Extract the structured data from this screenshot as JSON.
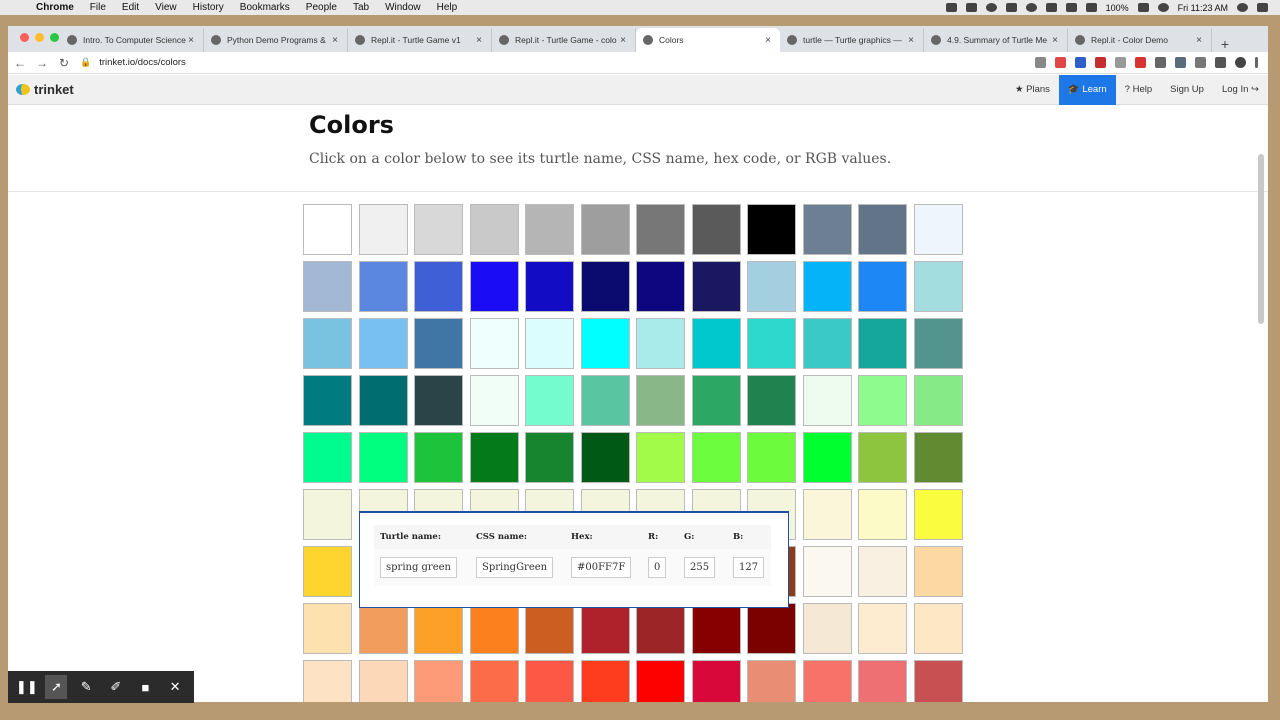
{
  "menubar": {
    "app": "Chrome",
    "items": [
      "File",
      "Edit",
      "View",
      "History",
      "Bookmarks",
      "People",
      "Tab",
      "Window",
      "Help"
    ],
    "battery": "100%",
    "clock": "Fri 11:23 AM"
  },
  "browser": {
    "tabs": [
      {
        "title": "Intro. To Computer Science",
        "active": false
      },
      {
        "title": "Python Demo Programs &",
        "active": false
      },
      {
        "title": "Repl.it - Turtle Game v1",
        "active": false
      },
      {
        "title": "Repl.it - Turtle Game - colo",
        "active": false
      },
      {
        "title": "Colors",
        "active": true
      },
      {
        "title": "turtle — Turtle graphics —",
        "active": false
      },
      {
        "title": "4.9. Summary of Turtle Me",
        "active": false
      },
      {
        "title": "Repl.it - Color Demo",
        "active": false
      }
    ],
    "url": "trinket.io/docs/colors"
  },
  "site": {
    "logo": "trinket",
    "nav": {
      "plans": "Plans",
      "learn": "Learn",
      "help": "Help",
      "signup": "Sign Up",
      "login": "Log In"
    },
    "title": "Colors",
    "subtitle": "Click on a color below to see its turtle name, CSS name, hex code, or RGB values."
  },
  "swatches": [
    "#ffffff",
    "#f0f0f0",
    "#d8d8d8",
    "#c9c9c9",
    "#b5b5b5",
    "#9e9e9e",
    "#777777",
    "#5a5a5a",
    "#000000",
    "#6d7f93",
    "#627488",
    "#eef5fd",
    "#a3b8d4",
    "#5b87e0",
    "#3f5fd6",
    "#1a0df5",
    "#120cc4",
    "#0a0a6f",
    "#0e067f",
    "#1b1862",
    "#a4cfe0",
    "#04b3f8",
    "#1d88f5",
    "#a4dde0",
    "#79c3e1",
    "#78bff2",
    "#3f76a6",
    "#effffe",
    "#dcfdfd",
    "#00ffff",
    "#a8ebea",
    "#00c8cc",
    "#2dd9cc",
    "#3ac9c4",
    "#15a69c",
    "#54948f",
    "#007b80",
    "#006d70",
    "#2a4448",
    "#f0fef7",
    "#74fbce",
    "#5ac5a1",
    "#89b788",
    "#2da864",
    "#20824e",
    "#eefcf0",
    "#8dfb8d",
    "#86ea87",
    "#00fb8f",
    "#00fe7f",
    "#1ec33c",
    "#047a1b",
    "#178530",
    "#005a16",
    "#a1fb48",
    "#6cfd3e",
    "#6dfc3d",
    "#00ff2f",
    "#8dc53e",
    "#608b30",
    "#f3f5dc",
    "#f3f5dc",
    "#f3f5dc",
    "#f3f5dc",
    "#f3f5dc",
    "#f3f5dc",
    "#f3f5dc",
    "#f3f5dc",
    "#f3f5dc",
    "#fbf6d9",
    "#fcfbc7",
    "#fafc40",
    "#fed52e",
    "#d7a12c",
    "#b07e27",
    "#f2deb3",
    "#d2b18c",
    "#d7ad86",
    "#cb7c40",
    "#9b4625",
    "#8d3c16",
    "#fbf8ef",
    "#f9f0e2",
    "#fdd8a2",
    "#fde1ae",
    "#f29d5d",
    "#fda028",
    "#fd801f",
    "#cc5e22",
    "#b0222b",
    "#9b2527",
    "#870000",
    "#7b0101",
    "#f5e8d5",
    "#fdecd0",
    "#fde7c4",
    "#fde2c4",
    "#fdd8b8",
    "#fd9b78",
    "#fd6c48",
    "#fd5745",
    "#fd3d1e",
    "#fd0000",
    "#d8093a",
    "#e98e74",
    "#f7736a",
    "#ef7072",
    "#c85052"
  ],
  "popup": {
    "headers": [
      "Turtle name:",
      "CSS name:",
      "Hex:",
      "R:",
      "G:",
      "B:"
    ],
    "values": [
      "spring green",
      "SpringGreen",
      "#00FF7F",
      "0",
      "255",
      "127"
    ]
  }
}
